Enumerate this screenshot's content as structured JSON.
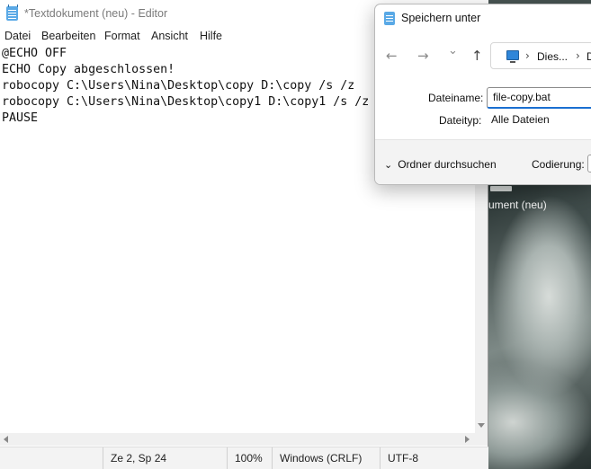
{
  "notepad": {
    "title": "*Textdokument (neu) - Editor",
    "menu": [
      "Datei",
      "Bearbeiten",
      "Format",
      "Ansicht",
      "Hilfe"
    ],
    "lines": [
      "@ECHO OFF",
      "ECHO Copy abgeschlossen!",
      "robocopy C:\\Users\\Nina\\Desktop\\copy D:\\copy /s /z",
      "robocopy C:\\Users\\Nina\\Desktop\\copy1 D:\\copy1 /s /z",
      "PAUSE"
    ],
    "status": {
      "position": "Ze 2, Sp 24",
      "zoom": "100%",
      "line_ending": "Windows (CRLF)",
      "encoding": "UTF-8"
    }
  },
  "dialog": {
    "title": "Speichern unter",
    "nav": {
      "back": "←",
      "forward": "→",
      "dropdown": "⌄",
      "up": "↑"
    },
    "address": {
      "sep1": "›",
      "part1": "Dies...",
      "sep2": "›",
      "part2": "D"
    },
    "filename_label": "Dateiname:",
    "filename_value": "file-copy.bat",
    "filetype_label": "Dateityp:",
    "filetype_value": "Alle Dateien",
    "browse_chevron": "⌄",
    "browse_label": "Ordner durchsuchen",
    "encoding_label": "Codierung:"
  },
  "desktop": {
    "background_label": "ument (neu)"
  },
  "colors": {
    "accent": "#1a6fd1",
    "notepad_icon": "#5aa9e6"
  }
}
